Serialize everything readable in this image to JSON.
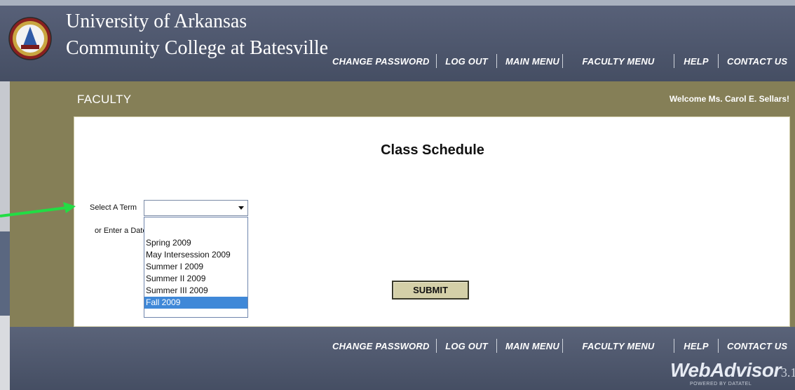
{
  "header": {
    "college_line1": "University of Arkansas",
    "college_line2": "Community College at Batesville",
    "logo_icon": "college-seal-icon"
  },
  "nav": {
    "change_password": "Change Password",
    "log_out": "Log Out",
    "main_menu": "Main Menu",
    "faculty_menu": "Faculty Menu",
    "help": "Help",
    "contact_us": "Contact Us"
  },
  "section": {
    "title": "FACULTY",
    "welcome": "Welcome Ms. Carol E. Sellars!"
  },
  "form": {
    "heading": "Class Schedule",
    "term_label": "Select A Term",
    "date_label": "or Enter a Date",
    "term_value": "",
    "term_options": [
      "Spring 2009",
      "May Intersession 2009",
      "Summer I 2009",
      "Summer II 2009",
      "Summer III 2009",
      "Fall 2009"
    ],
    "highlighted_option": "Fall 2009",
    "submit_label": "SUBMIT"
  },
  "footer": {
    "brand": "WebAdvisor",
    "version": "3.1",
    "powered_by": "POWERED BY DATATEL"
  },
  "colors": {
    "header_bg": "#4d566c",
    "olive_bg": "#857f57",
    "highlight": "#3f88d8",
    "arrow": "#22dd44"
  }
}
